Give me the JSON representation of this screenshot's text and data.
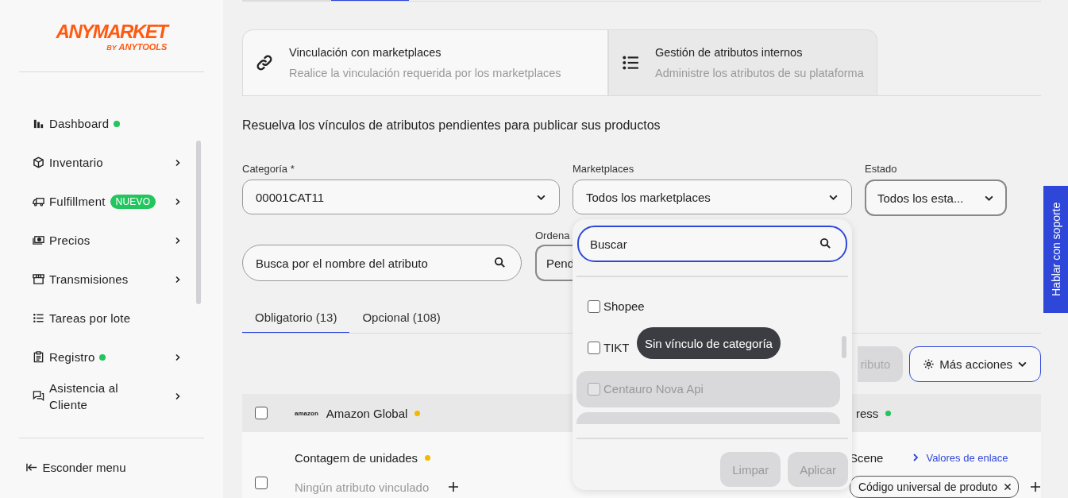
{
  "sidebar": {
    "logo": {
      "brand": "ANYMARKET",
      "by": "BY",
      "maker": "ANYTOOLS"
    },
    "items": [
      {
        "label": "Dashboard",
        "dot": true,
        "submenu": false
      },
      {
        "label": "Inventario",
        "dot": false,
        "submenu": true
      },
      {
        "label": "Fulfillment",
        "dot": false,
        "badge": "NUEVO",
        "submenu": true
      },
      {
        "label": "Precios",
        "dot": false,
        "submenu": true
      },
      {
        "label": "Transmisiones",
        "dot": false,
        "submenu": true
      },
      {
        "label": "Tareas por lote",
        "dot": false,
        "submenu": false
      },
      {
        "label": "Registro",
        "dot": true,
        "submenu": true
      },
      {
        "label": "Asistencia al Cliente",
        "dot": false,
        "submenu": true
      }
    ],
    "footer": "Esconder menu"
  },
  "top_tabs": [
    {
      "selected": false
    },
    {
      "selected": true
    }
  ],
  "mode_cards": [
    {
      "title": "Vinculación con marketplaces",
      "subtitle": "Realice la vinculación requerida por los marketplaces",
      "selected": true
    },
    {
      "title": "Gestión de atributos internos",
      "subtitle": "Administre los atributos de su plataforma",
      "selected": false
    }
  ],
  "heading": "Resuelva los vínculos de atributos pendientes para publicar sus productos",
  "filters": {
    "category": {
      "label": "Categoría *",
      "value": "00001CAT11"
    },
    "marketplaces": {
      "label": "Marketplaces",
      "value": "Todos los marketplaces"
    },
    "status": {
      "label": "Estado",
      "value": "Todos los esta..."
    },
    "search": {
      "placeholder": "Busca por el nombre del atributo"
    },
    "order": {
      "label": "Ordena",
      "value": "Pend"
    }
  },
  "attribute_tabs": [
    {
      "label": "Obligatorio (13)",
      "selected": true
    },
    {
      "label": "Opcional (108)",
      "selected": false
    }
  ],
  "actions": {
    "partial_button": "ributo",
    "more_button": "Más acciones"
  },
  "table": {
    "header_checkbox": {
      "checked": false
    },
    "columns": [
      {
        "label": "Amazon Global",
        "logo_text": "amazon",
        "color": "#f5b800"
      },
      {
        "label": "ress",
        "color": "#22c55e"
      }
    ],
    "rows": [
      {
        "checked": false,
        "attribute": "Contagem de unidades",
        "color": "#f5b800",
        "linked": "Ningún atributo vinculado",
        "marketplace_value": "Scene",
        "link": "Valores de enlace",
        "chip": "Código universal de produto"
      }
    ]
  },
  "marketplace_dropdown": {
    "search": {
      "placeholder": "Buscar"
    },
    "options": [
      {
        "label": "Shopee",
        "checked": false,
        "disabled": false
      },
      {
        "label": "TIKT",
        "checked": false,
        "disabled": false
      },
      {
        "label": "Centauro Nova Api",
        "checked": false,
        "disabled": true
      }
    ],
    "buttons": [
      {
        "label": "Limpar",
        "disabled": true
      },
      {
        "label": "Aplicar",
        "disabled": true
      }
    ]
  },
  "tooltip": "Sin vínculo de categoría",
  "support_tab": "Hablar con soporte"
}
